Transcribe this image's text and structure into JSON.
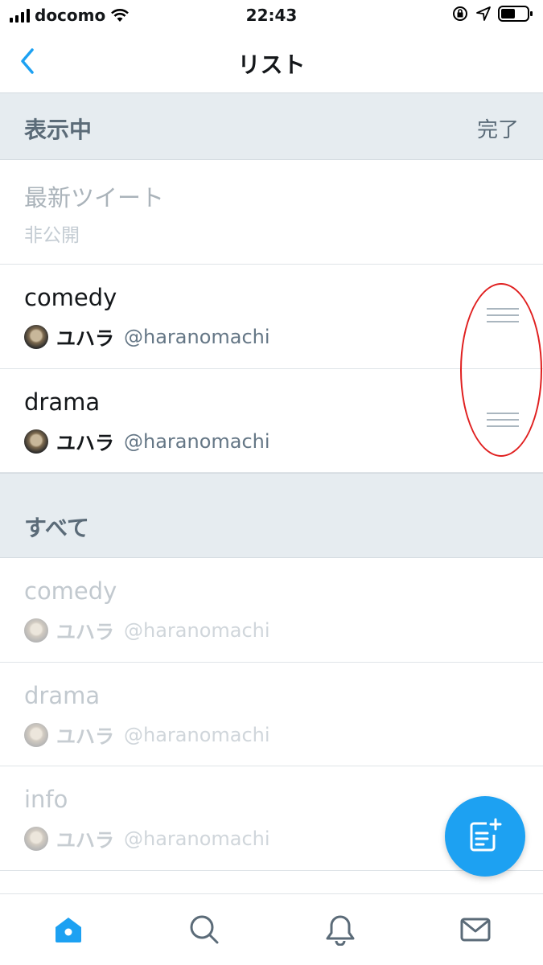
{
  "status_bar": {
    "carrier": "docomo",
    "time": "22:43"
  },
  "nav": {
    "title": "リスト",
    "back_icon": "chevron-left-icon"
  },
  "pinned_section": {
    "title": "表示中",
    "done_label": "完了",
    "default_item": {
      "title": "最新ツイート",
      "subtitle": "非公開"
    },
    "items": [
      {
        "title": "comedy",
        "owner_name": "ユハラ",
        "owner_handle": "@haranomachi"
      },
      {
        "title": "drama",
        "owner_name": "ユハラ",
        "owner_handle": "@haranomachi"
      }
    ]
  },
  "all_section": {
    "title": "すべて",
    "items": [
      {
        "title": "comedy",
        "owner_name": "ユハラ",
        "owner_handle": "@haranomachi"
      },
      {
        "title": "drama",
        "owner_name": "ユハラ",
        "owner_handle": "@haranomachi"
      },
      {
        "title": "info",
        "owner_name": "ユハラ",
        "owner_handle": "@haranomachi"
      }
    ]
  },
  "fab": {
    "icon": "compose-list-icon"
  },
  "tab_bar": {
    "tabs": [
      {
        "icon": "home-icon",
        "active": true
      },
      {
        "icon": "search-icon",
        "active": false
      },
      {
        "icon": "bell-icon",
        "active": false
      },
      {
        "icon": "mail-icon",
        "active": false
      }
    ]
  },
  "colors": {
    "accent": "#1da1f2",
    "section_bg": "#e6ecf0",
    "annotation": "#e02020"
  }
}
